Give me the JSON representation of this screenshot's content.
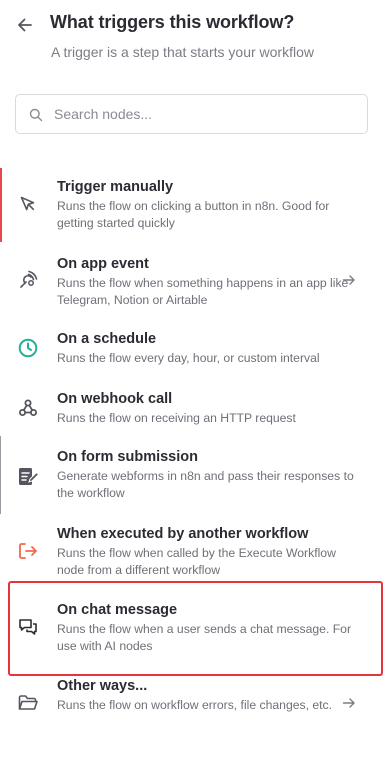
{
  "header": {
    "title": "What triggers this workflow?",
    "subtitle": "A trigger is a step that starts your workflow"
  },
  "search": {
    "placeholder": "Search nodes..."
  },
  "items": [
    {
      "title": "Trigger manually",
      "desc": "Runs the flow on clicking a button in n8n. Good for getting started quickly",
      "icon": "cursor-icon"
    },
    {
      "title": "On app event",
      "desc": "Runs the flow when something happens in an app like Telegram, Notion or Airtable",
      "icon": "app-event-icon"
    },
    {
      "title": "On a schedule",
      "desc": "Runs the flow every day, hour, or custom interval",
      "icon": "clock-icon"
    },
    {
      "title": "On webhook call",
      "desc": "Runs the flow on receiving an HTTP request",
      "icon": "webhook-icon"
    },
    {
      "title": "On form submission",
      "desc": "Generate webforms in n8n and pass their responses to the workflow",
      "icon": "form-icon"
    },
    {
      "title": "When executed by another workflow",
      "desc": "Runs the flow when called by the Execute Workflow node from a different workflow",
      "icon": "sign-in-icon"
    },
    {
      "title": "On chat message",
      "desc": "Runs the flow when a user sends a chat message. For use with AI nodes",
      "icon": "chat-icon"
    },
    {
      "title": "Other ways...",
      "desc": "Runs the flow on workflow errors, file changes, etc.",
      "icon": "folder-icon"
    }
  ],
  "colors": {
    "accent_manual": "#e5484d",
    "schedule_icon": "#27b098",
    "sign_in_icon": "#f16a4b",
    "highlight_border": "#e5343b"
  }
}
